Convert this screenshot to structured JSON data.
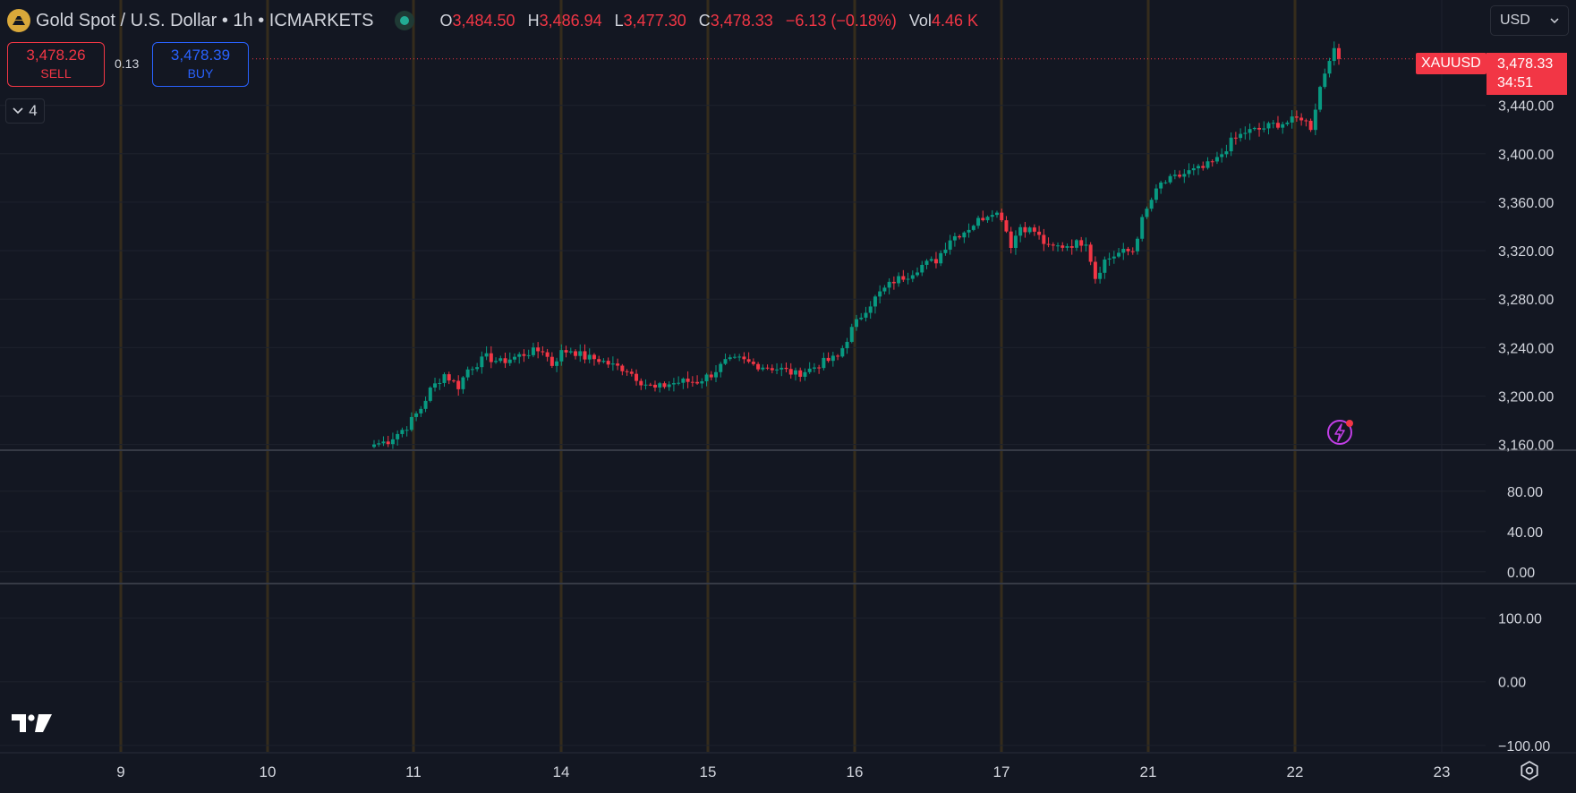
{
  "header": {
    "symbol_title": "Gold Spot / U.S. Dollar • 1h • ICMARKETS",
    "ohlc": [
      {
        "k": "O",
        "v": "3,484.50"
      },
      {
        "k": "H",
        "v": "3,486.94"
      },
      {
        "k": "L",
        "v": "3,477.30"
      },
      {
        "k": "C",
        "v": "3,478.33"
      },
      {
        "k": "",
        "v": "−6.13 (−0.18%)"
      },
      {
        "k": "Vol",
        "v": "4.46 K"
      }
    ]
  },
  "trade": {
    "sell_price": "3,478.26",
    "sell_label": "SELL",
    "buy_price": "3,478.39",
    "buy_label": "BUY",
    "spread": "0.13"
  },
  "indicators_collapse": {
    "count": "4"
  },
  "currency_select": {
    "value": "USD"
  },
  "last_price": {
    "symbol": "XAUUSD",
    "price": "3,478.33",
    "countdown": "34:51"
  },
  "colors": {
    "background": "#131722",
    "up": "#089981",
    "down": "#f23645",
    "grid": "#1e222d",
    "session": "#3a2f1c",
    "text": "#d1d4dc"
  },
  "icons": [
    "gold-coin-icon",
    "chevron-down-icon",
    "lightning-alert-icon",
    "tradingview-logo-icon",
    "settings-icon"
  ],
  "chart_data": {
    "type": "candlestick",
    "x_tick_labels": [
      "9",
      "10",
      "11",
      "14",
      "15",
      "16",
      "17",
      "21",
      "22",
      "23"
    ],
    "price_axis": {
      "ticks": [
        3160,
        3200,
        3240,
        3280,
        3320,
        3360,
        3400,
        3440
      ],
      "tick_labels": [
        "3,160.00",
        "3,200.00",
        "3,240.00",
        "3,280.00",
        "3,320.00",
        "3,360.00",
        "3,400.00",
        "3,440.00"
      ],
      "ylim": [
        3156,
        3490
      ]
    },
    "pane2_axis": {
      "tick_labels": [
        "80.00",
        "40.00",
        "0.00"
      ],
      "ylim": [
        -10,
        110
      ]
    },
    "pane3_axis": {
      "tick_labels": [
        "100.00",
        "0.00",
        "−100.00"
      ],
      "ylim": [
        -110,
        150
      ]
    },
    "price_anchors": [
      [
        0,
        3160
      ],
      [
        3,
        3163
      ],
      [
        7,
        3175
      ],
      [
        10,
        3190
      ],
      [
        12,
        3205
      ],
      [
        15,
        3218
      ],
      [
        18,
        3208
      ],
      [
        20,
        3222
      ],
      [
        24,
        3232
      ],
      [
        27,
        3228
      ],
      [
        30,
        3232
      ],
      [
        33,
        3236
      ],
      [
        36,
        3238
      ],
      [
        38,
        3226
      ],
      [
        40,
        3236
      ],
      [
        42,
        3238
      ],
      [
        45,
        3232
      ],
      [
        48,
        3230
      ],
      [
        51,
        3225
      ],
      [
        54,
        3222
      ],
      [
        57,
        3212
      ],
      [
        60,
        3206
      ],
      [
        63,
        3210
      ],
      [
        66,
        3212
      ],
      [
        69,
        3212
      ],
      [
        72,
        3218
      ],
      [
        75,
        3228
      ],
      [
        78,
        3230
      ],
      [
        81,
        3226
      ],
      [
        84,
        3224
      ],
      [
        87,
        3222
      ],
      [
        90,
        3218
      ],
      [
        93,
        3222
      ],
      [
        96,
        3228
      ],
      [
        99,
        3232
      ],
      [
        102,
        3255
      ],
      [
        105,
        3272
      ],
      [
        108,
        3285
      ],
      [
        111,
        3295
      ],
      [
        114,
        3300
      ],
      [
        117,
        3308
      ],
      [
        120,
        3312
      ],
      [
        123,
        3330
      ],
      [
        126,
        3336
      ],
      [
        129,
        3345
      ],
      [
        132,
        3353
      ],
      [
        134,
        3348
      ],
      [
        136,
        3325
      ],
      [
        138,
        3340
      ],
      [
        141,
        3336
      ],
      [
        144,
        3322
      ],
      [
        147,
        3324
      ],
      [
        150,
        3326
      ],
      [
        152,
        3328
      ],
      [
        154,
        3298
      ],
      [
        156,
        3312
      ],
      [
        159,
        3318
      ],
      [
        162,
        3320
      ],
      [
        164,
        3345
      ],
      [
        166,
        3362
      ],
      [
        168,
        3375
      ],
      [
        171,
        3380
      ],
      [
        174,
        3385
      ],
      [
        177,
        3388
      ],
      [
        180,
        3395
      ],
      [
        183,
        3410
      ],
      [
        186,
        3418
      ],
      [
        189,
        3420
      ],
      [
        192,
        3424
      ],
      [
        195,
        3426
      ],
      [
        198,
        3430
      ],
      [
        200,
        3422
      ],
      [
        202,
        3455
      ],
      [
        204,
        3480
      ],
      [
        205,
        3484
      ],
      [
        206,
        3478.33
      ]
    ],
    "last_value": 3478.33
  }
}
